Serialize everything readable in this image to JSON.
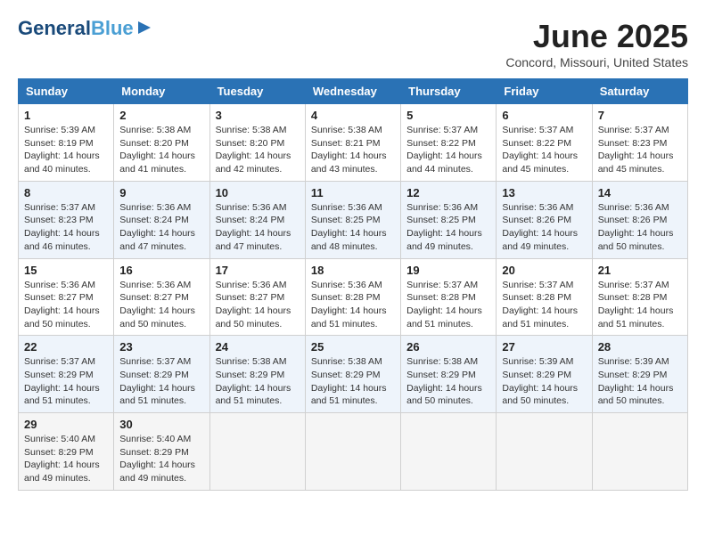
{
  "logo": {
    "line1": "General",
    "line2": "Blue"
  },
  "title": "June 2025",
  "location": "Concord, Missouri, United States",
  "days_of_week": [
    "Sunday",
    "Monday",
    "Tuesday",
    "Wednesday",
    "Thursday",
    "Friday",
    "Saturday"
  ],
  "weeks": [
    [
      {
        "day": "1",
        "sunrise": "5:39 AM",
        "sunset": "8:19 PM",
        "daylight": "14 hours and 40 minutes."
      },
      {
        "day": "2",
        "sunrise": "5:38 AM",
        "sunset": "8:20 PM",
        "daylight": "14 hours and 41 minutes."
      },
      {
        "day": "3",
        "sunrise": "5:38 AM",
        "sunset": "8:20 PM",
        "daylight": "14 hours and 42 minutes."
      },
      {
        "day": "4",
        "sunrise": "5:38 AM",
        "sunset": "8:21 PM",
        "daylight": "14 hours and 43 minutes."
      },
      {
        "day": "5",
        "sunrise": "5:37 AM",
        "sunset": "8:22 PM",
        "daylight": "14 hours and 44 minutes."
      },
      {
        "day": "6",
        "sunrise": "5:37 AM",
        "sunset": "8:22 PM",
        "daylight": "14 hours and 45 minutes."
      },
      {
        "day": "7",
        "sunrise": "5:37 AM",
        "sunset": "8:23 PM",
        "daylight": "14 hours and 45 minutes."
      }
    ],
    [
      {
        "day": "8",
        "sunrise": "5:37 AM",
        "sunset": "8:23 PM",
        "daylight": "14 hours and 46 minutes."
      },
      {
        "day": "9",
        "sunrise": "5:36 AM",
        "sunset": "8:24 PM",
        "daylight": "14 hours and 47 minutes."
      },
      {
        "day": "10",
        "sunrise": "5:36 AM",
        "sunset": "8:24 PM",
        "daylight": "14 hours and 47 minutes."
      },
      {
        "day": "11",
        "sunrise": "5:36 AM",
        "sunset": "8:25 PM",
        "daylight": "14 hours and 48 minutes."
      },
      {
        "day": "12",
        "sunrise": "5:36 AM",
        "sunset": "8:25 PM",
        "daylight": "14 hours and 49 minutes."
      },
      {
        "day": "13",
        "sunrise": "5:36 AM",
        "sunset": "8:26 PM",
        "daylight": "14 hours and 49 minutes."
      },
      {
        "day": "14",
        "sunrise": "5:36 AM",
        "sunset": "8:26 PM",
        "daylight": "14 hours and 50 minutes."
      }
    ],
    [
      {
        "day": "15",
        "sunrise": "5:36 AM",
        "sunset": "8:27 PM",
        "daylight": "14 hours and 50 minutes."
      },
      {
        "day": "16",
        "sunrise": "5:36 AM",
        "sunset": "8:27 PM",
        "daylight": "14 hours and 50 minutes."
      },
      {
        "day": "17",
        "sunrise": "5:36 AM",
        "sunset": "8:27 PM",
        "daylight": "14 hours and 50 minutes."
      },
      {
        "day": "18",
        "sunrise": "5:36 AM",
        "sunset": "8:28 PM",
        "daylight": "14 hours and 51 minutes."
      },
      {
        "day": "19",
        "sunrise": "5:37 AM",
        "sunset": "8:28 PM",
        "daylight": "14 hours and 51 minutes."
      },
      {
        "day": "20",
        "sunrise": "5:37 AM",
        "sunset": "8:28 PM",
        "daylight": "14 hours and 51 minutes."
      },
      {
        "day": "21",
        "sunrise": "5:37 AM",
        "sunset": "8:28 PM",
        "daylight": "14 hours and 51 minutes."
      }
    ],
    [
      {
        "day": "22",
        "sunrise": "5:37 AM",
        "sunset": "8:29 PM",
        "daylight": "14 hours and 51 minutes."
      },
      {
        "day": "23",
        "sunrise": "5:37 AM",
        "sunset": "8:29 PM",
        "daylight": "14 hours and 51 minutes."
      },
      {
        "day": "24",
        "sunrise": "5:38 AM",
        "sunset": "8:29 PM",
        "daylight": "14 hours and 51 minutes."
      },
      {
        "day": "25",
        "sunrise": "5:38 AM",
        "sunset": "8:29 PM",
        "daylight": "14 hours and 51 minutes."
      },
      {
        "day": "26",
        "sunrise": "5:38 AM",
        "sunset": "8:29 PM",
        "daylight": "14 hours and 50 minutes."
      },
      {
        "day": "27",
        "sunrise": "5:39 AM",
        "sunset": "8:29 PM",
        "daylight": "14 hours and 50 minutes."
      },
      {
        "day": "28",
        "sunrise": "5:39 AM",
        "sunset": "8:29 PM",
        "daylight": "14 hours and 50 minutes."
      }
    ],
    [
      {
        "day": "29",
        "sunrise": "5:40 AM",
        "sunset": "8:29 PM",
        "daylight": "14 hours and 49 minutes."
      },
      {
        "day": "30",
        "sunrise": "5:40 AM",
        "sunset": "8:29 PM",
        "daylight": "14 hours and 49 minutes."
      },
      null,
      null,
      null,
      null,
      null
    ]
  ],
  "labels": {
    "sunrise": "Sunrise:",
    "sunset": "Sunset:",
    "daylight": "Daylight:"
  }
}
